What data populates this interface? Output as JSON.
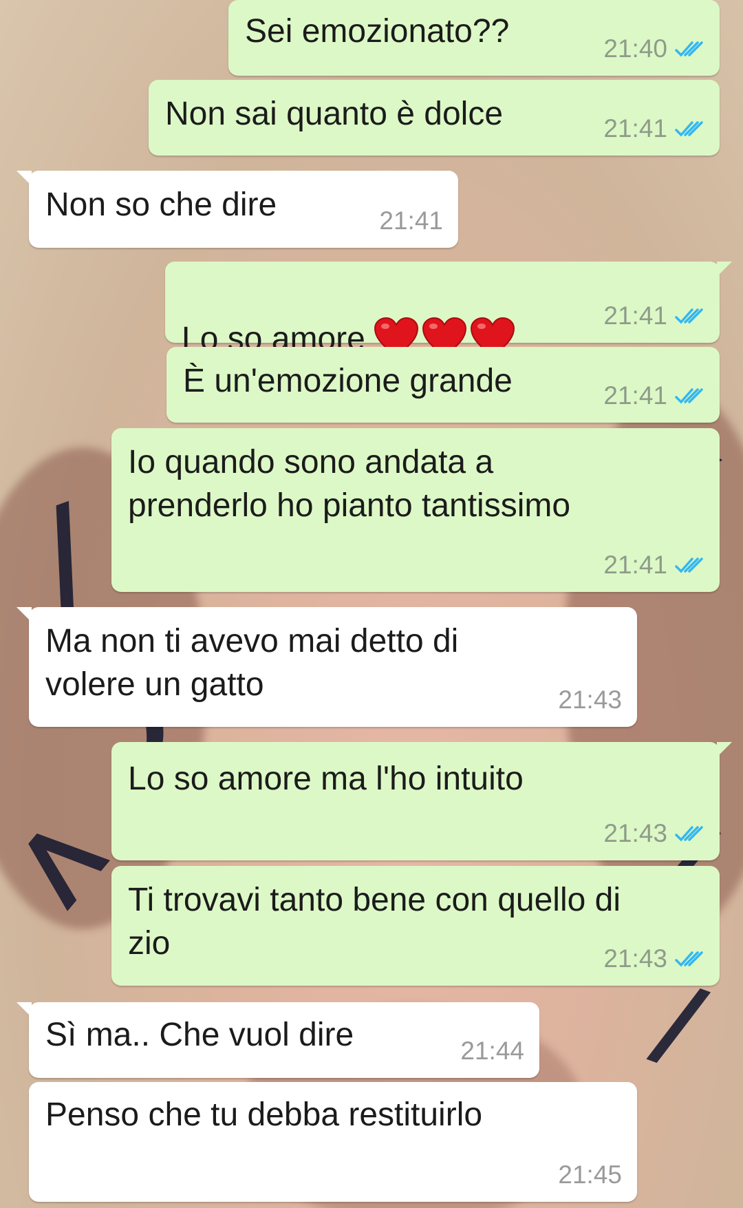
{
  "chat": {
    "messages": [
      {
        "text": "Sei emozionato??",
        "time": "21:40"
      },
      {
        "text": "Non sai quanto è dolce",
        "time": "21:41"
      },
      {
        "text": "Non so che dire",
        "time": "21:41"
      },
      {
        "text": "Lo so amore",
        "time": "21:41",
        "emoji": "❤️❤️❤️"
      },
      {
        "text": "È un'emozione grande",
        "time": "21:41"
      },
      {
        "text": "Io quando sono andata a\nprenderlo ho pianto tantissimo",
        "time": "21:41"
      },
      {
        "text": "Ma non ti avevo mai detto di\nvolere un gatto",
        "time": "21:43"
      },
      {
        "text": "Lo so amore ma l'ho intuito",
        "time": "21:43"
      },
      {
        "text": "Ti trovavi tanto bene con quello di\nzio",
        "time": "21:43"
      },
      {
        "text": "Sì ma.. Che vuol dire",
        "time": "21:44"
      },
      {
        "text": "Penso che tu debba restituirlo",
        "time": "21:45"
      }
    ]
  },
  "colors": {
    "outgoing_bubble": "#dcf8c6",
    "incoming_bubble": "#ffffff",
    "read_tick": "#34b7f1"
  },
  "icons": {
    "read_receipt": "double-check-icon",
    "heart": "red-heart-icon"
  }
}
